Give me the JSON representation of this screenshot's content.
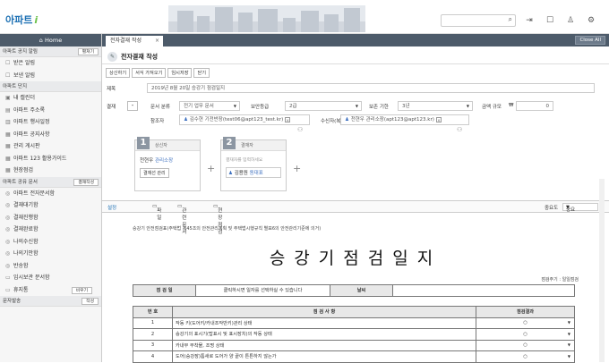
{
  "app": {
    "logo_text": "아파트",
    "logo_accent": "i",
    "brand_color": "#1b6fb3"
  },
  "header": {
    "search_placeholder": "",
    "icons": [
      "search-icon",
      "exit-icon",
      "chat-icon",
      "user-icon",
      "gear-icon"
    ]
  },
  "sidebar": {
    "home": "Home",
    "sections": [
      {
        "label": "아파트 공지 알림",
        "button": "펼쳐기"
      },
      {
        "label": "아파트 단지",
        "button": ""
      },
      {
        "label": "아파트 공유 문서",
        "button": "결재작성"
      },
      {
        "label": "문자발송",
        "button": "작성"
      }
    ],
    "items_a": [
      "받은 알림",
      "보낸 알림"
    ],
    "items_b": [
      "내 캘린더",
      "아파트 주소록",
      "아파트 행사일정",
      "아파트 공지사항",
      "관리 게시판",
      "아파트 123 활용가이드",
      "현장점검"
    ],
    "items_c": [
      "아파트 전자문서함",
      "결재대기함",
      "결재진행함",
      "결재완료함",
      "나의수신함",
      "나의기안함",
      "반송함",
      "임시보관 문서함",
      "휴지통"
    ],
    "trash_button": "비우기"
  },
  "tabs": {
    "active": "전자결재 작성",
    "close_all": "Close All"
  },
  "page": {
    "title": "전자결재 작성",
    "actions": [
      "상신하기",
      "서식 가져오기",
      "임시저장",
      "닫기"
    ],
    "subject_label": "제목",
    "subject_value": "2019년 8월 20일 승강기 점검일지",
    "approval_label": "결재",
    "approval_btn": "-",
    "doc_type_label": "문서 분류",
    "doc_type_value": "전기 업무 문서",
    "security_label": "보안등급",
    "security_value": "2급",
    "retention_label": "보존 기한",
    "retention_value": "3년",
    "amount_label": "금액 규모",
    "currency": "₩",
    "amount_value": "0",
    "reference_label": "참조자",
    "reference_value": "김수현 기전반장(test06@apt123_test.kr)",
    "receiver_label": "수신자(복)",
    "receiver_value": "천현우 관리소장(apt123@apt123.kr)"
  },
  "steps": [
    {
      "num": "1",
      "role": "상신자",
      "name": "천현우",
      "title": "관리소장",
      "sub": "결재선 관리"
    },
    {
      "num": "2",
      "role": "결재자",
      "placeholder": "결재자를 입력하세요",
      "name": "김용원",
      "title": "동대표"
    }
  ],
  "subtabs": {
    "items": [
      "설정",
      "파일",
      "관련문서",
      "현장점검"
    ],
    "priority_label": "중요도",
    "priority_value": "중요"
  },
  "document": {
    "note": "승강기 안전점검표(주택법 제45조의 안전관리계획 및 주택법시행규칙 별표6의 안전관리기준에 의거)",
    "title": "승강기점검일지",
    "period": "점검주기 : 일일점검",
    "inspector_label": "점 검 일",
    "inspector_value": "클릭하시면 일자를 선택하실 수 있습니다",
    "confirm_label": "날씨",
    "confirm_value": "",
    "col_no": "번 호",
    "col_item": "점 검 사 항",
    "col_result": "점검결과",
    "rows": [
      {
        "no": "1",
        "item": "작동 키(도어키/카내조작반키)관리 상태",
        "result": "○"
      },
      {
        "no": "2",
        "item": "승강기의 표시기(탑표시 및 표시장치)의 작동 상태",
        "result": "○"
      },
      {
        "no": "3",
        "item": "카내부 부착물, 조명 상태",
        "result": "○"
      },
      {
        "no": "4",
        "item": "도어(승강장)틈새로 도어가 양 끝이 튼튼하지 않는가",
        "result": "○"
      }
    ]
  }
}
